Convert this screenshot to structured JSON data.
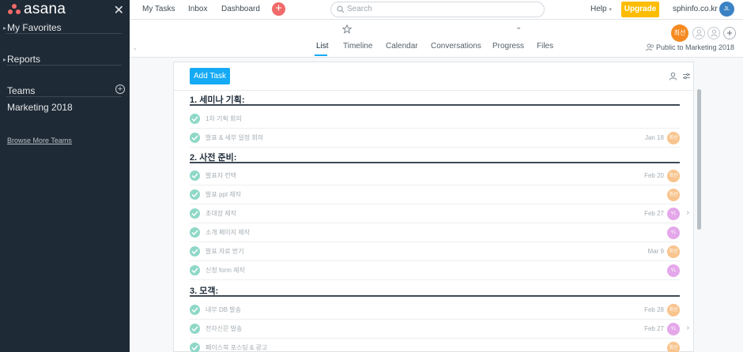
{
  "sidebar": {
    "logo_text": "asana",
    "favorites_label": "My Favorites",
    "reports_label": "Reports",
    "teams_label": "Teams",
    "team_name": "Marketing 2018",
    "browse_label": "Browse More Teams"
  },
  "topbar": {
    "nav": [
      "My Tasks",
      "Inbox",
      "Dashboard"
    ],
    "search_placeholder": "Search",
    "help_label": "Help",
    "upgrade_label": "Upgrade",
    "domain": "sphinfo.co.kr",
    "user_initials": "JL"
  },
  "project": {
    "tabs": [
      "List",
      "Timeline",
      "Calendar",
      "Conversations",
      "Progress",
      "Files"
    ],
    "active_tab": "List",
    "member_label": "최선",
    "public_label": "Public to Marketing 2018"
  },
  "list": {
    "add_task_label": "Add Task",
    "sections": [
      {
        "title": "1. 세미나 기획:",
        "tasks": [
          {
            "name": "1차 기획 회의",
            "date": "",
            "assignee": ""
          },
          {
            "name": "발표 & 세부 일정 회의",
            "date": "Jan 18",
            "assignee": "최선"
          }
        ]
      },
      {
        "title": "2. 사전 준비:",
        "tasks": [
          {
            "name": "발표자 컨택",
            "date": "Feb 20",
            "assignee": "최선"
          },
          {
            "name": "발표 ppt 제작",
            "date": "",
            "assignee": "최선"
          },
          {
            "name": "초대장 제작",
            "date": "Feb 27",
            "assignee": "YL"
          },
          {
            "name": "소개 페이지 제작",
            "date": "",
            "assignee": "YL"
          },
          {
            "name": "발표 자료 받기",
            "date": "Mar 9",
            "assignee": "최선"
          },
          {
            "name": "신청 form 제작",
            "date": "",
            "assignee": "YL"
          }
        ]
      },
      {
        "title": "3. 모객:",
        "tasks": [
          {
            "name": "내부 DB 발송",
            "date": "Feb 28",
            "assignee": "최선"
          },
          {
            "name": "전자신문 발송",
            "date": "Feb 27",
            "assignee": "YL"
          },
          {
            "name": "페이스북 포스팅 & 광고",
            "date": "",
            "assignee": "최선"
          }
        ]
      }
    ]
  },
  "colors": {
    "sidebar_bg": "#1e2a35",
    "accent_blue": "#14aaf5",
    "upgrade_yellow": "#fcbd01",
    "brand_coral": "#f06a6a",
    "check_green": "#8fd8c8"
  }
}
